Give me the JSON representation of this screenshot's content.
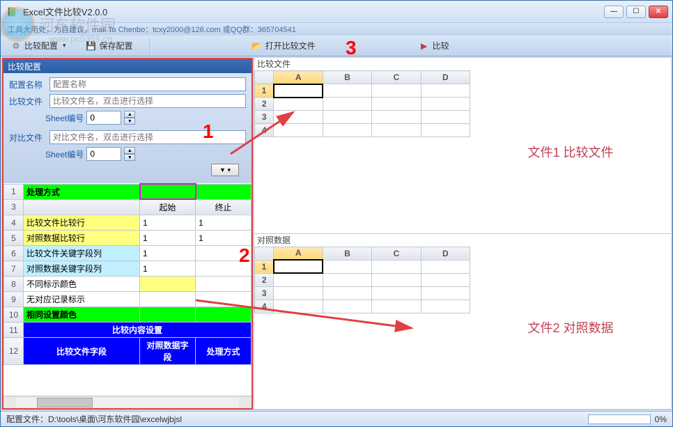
{
  "window": {
    "title": "Excel文件比较V2.0.0",
    "subtitle": "工具大用处，为自建议，mail To Chenbo：tcxy2000@126.com  或QQ群：365704541"
  },
  "toolbar": {
    "compare_config": "比较配置",
    "save_config": "保存配置",
    "open_compare_file": "打开比较文件",
    "compare": "比较"
  },
  "panel": {
    "title": "比较配置",
    "config_name_label": "配置名称",
    "config_name_placeholder": "配置名称",
    "compare_file_label": "比较文件",
    "compare_file_placeholder": "比较文件名，双击进行选择",
    "contrast_file_label": "对比文件",
    "contrast_file_placeholder": "对比文件名，双击进行选择",
    "sheet_no_label": "Sheet编号",
    "sheet_no_value": "0"
  },
  "config_grid": {
    "row1_label": "处理方式",
    "col_start": "起始",
    "col_end": "终止",
    "rows": [
      {
        "num": "4",
        "label": "比较文件比较行",
        "start": "1",
        "end": "1",
        "cls": "cg-yellow"
      },
      {
        "num": "5",
        "label": "对照数据比较行",
        "start": "1",
        "end": "1",
        "cls": "cg-yellow"
      },
      {
        "num": "6",
        "label": "比较文件关键字段列",
        "start": "1",
        "end": "",
        "cls": "cg-cyan"
      },
      {
        "num": "7",
        "label": "对照数据关键字段列",
        "start": "1",
        "end": "",
        "cls": "cg-cyan"
      },
      {
        "num": "8",
        "label": "不同标示颜色",
        "start": "",
        "end": "",
        "cls": ""
      },
      {
        "num": "9",
        "label": "无对应记录标示",
        "start": "",
        "end": "",
        "cls": ""
      },
      {
        "num": "10",
        "label": "相同设置颜色",
        "start": "",
        "end": "",
        "cls": "cg-green"
      }
    ],
    "row11": "比较内容设置",
    "row12_c1": "比较文件字段",
    "row12_c2": "对照数据字段",
    "row12_c3": "处理方式"
  },
  "right": {
    "sec1_title": "比较文件",
    "sec1_label": "文件1 比较文件",
    "sec2_title": "对照数据",
    "sec2_label": "文件2 对照数据",
    "cols": [
      "A",
      "B",
      "C",
      "D"
    ],
    "rows": [
      "1",
      "2",
      "3",
      "4"
    ]
  },
  "statusbar": {
    "path_label": "配置文件：D:\\tools\\桌面\\河东软件园\\excelwjbjsl",
    "progress": "0%"
  },
  "watermark": {
    "text": "河东软件园",
    "url": "www.pc0359.cn"
  },
  "annotations": {
    "a1": "1",
    "a2": "2",
    "a3": "3"
  }
}
